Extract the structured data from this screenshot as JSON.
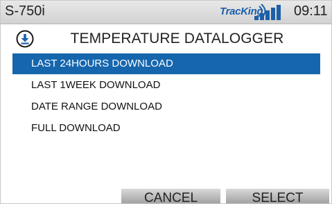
{
  "statusbar": {
    "model": "S-750i",
    "brand_logo": "TracKing",
    "brand_icon": "signal-arc-icon",
    "signal_icon": "signal-strength-icon",
    "time": "09:11"
  },
  "header": {
    "icon": "download-icon",
    "title": "TEMPERATURE DATALOGGER"
  },
  "menu": {
    "items": [
      {
        "label": "LAST 24HOURS DOWNLOAD",
        "selected": true
      },
      {
        "label": "LAST 1WEEK DOWNLOAD",
        "selected": false
      },
      {
        "label": "DATE RANGE DOWNLOAD",
        "selected": false
      },
      {
        "label": "FULL DOWNLOAD",
        "selected": false
      }
    ]
  },
  "softkeys": {
    "cancel_label": "CANCEL",
    "select_label": "SELECT"
  },
  "colors": {
    "selection": "#1666ad",
    "brand": "#1c5fa8",
    "signal": "#1c5fa8"
  }
}
